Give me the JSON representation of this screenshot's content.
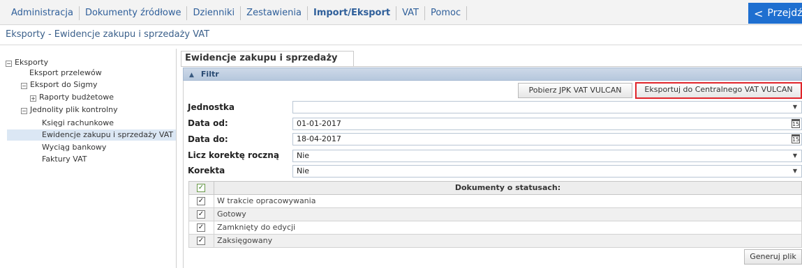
{
  "menu": {
    "items": [
      {
        "label": "Administracja",
        "active": false
      },
      {
        "label": "Dokumenty źródłowe",
        "active": false
      },
      {
        "label": "Dzienniki",
        "active": false
      },
      {
        "label": "Zestawienia",
        "active": false
      },
      {
        "label": "Import/Eksport",
        "active": true
      },
      {
        "label": "VAT",
        "active": false
      },
      {
        "label": "Pomoc",
        "active": false
      }
    ],
    "przejdz_label": "Przejdź",
    "przejdz_icon": "chevron-left-icon"
  },
  "breadcrumb": "Eksporty - Ewidencje zakupu i sprzedaży VAT",
  "tree": {
    "root": {
      "label": "Eksporty",
      "expander": "⊟"
    },
    "export_przelewow": "Eksport przelewów",
    "sigma": {
      "label": "Eksport do Sigmy",
      "expander": "⊟"
    },
    "raporty": {
      "label": "Raporty budżetowe",
      "expander": "⊞"
    },
    "jpk": {
      "label": "Jednolity plik kontrolny",
      "expander": "⊟"
    },
    "ksiegi": "Księgi rachunkowe",
    "ewidencje": "Ewidencje zakupu i sprzedaży VAT",
    "wyciag": "Wyciąg bankowy",
    "faktury": "Faktury VAT"
  },
  "main": {
    "tab_label": "Ewidencje zakupu i sprzedaży VAT",
    "filter_label": "Filtr",
    "btn_pobierz": "Pobierz JPK VAT VULCAN",
    "btn_eksportuj": "Eksportuj do Centralnego VAT VULCAN",
    "form": {
      "jednostka": {
        "label": "Jednostka",
        "value": ""
      },
      "data_od": {
        "label": "Data od:",
        "value": "01-01-2017"
      },
      "data_do": {
        "label": "Data do:",
        "value": "18-04-2017"
      },
      "licz": {
        "label": "Licz korektę roczną",
        "value": "Nie"
      },
      "korekta": {
        "label": "Korekta",
        "value": "Nie"
      }
    },
    "calendar_glyph": "15",
    "grid": {
      "header": "Dokumenty o statusach:",
      "rows": [
        {
          "label": "W trakcie opracowywania",
          "checked": true
        },
        {
          "label": "Gotowy",
          "checked": true
        },
        {
          "label": "Zamknięty do edycji",
          "checked": true
        },
        {
          "label": "Zaksięgowany",
          "checked": true
        }
      ]
    },
    "btn_generuj": "Generuj plik"
  },
  "colors": {
    "accent": "#1e6fd0",
    "link": "#2f5f9a",
    "highlight_border": "#e0242a",
    "filter_bar": "#c4d3e4",
    "selected_row": "#dbe7f4"
  }
}
